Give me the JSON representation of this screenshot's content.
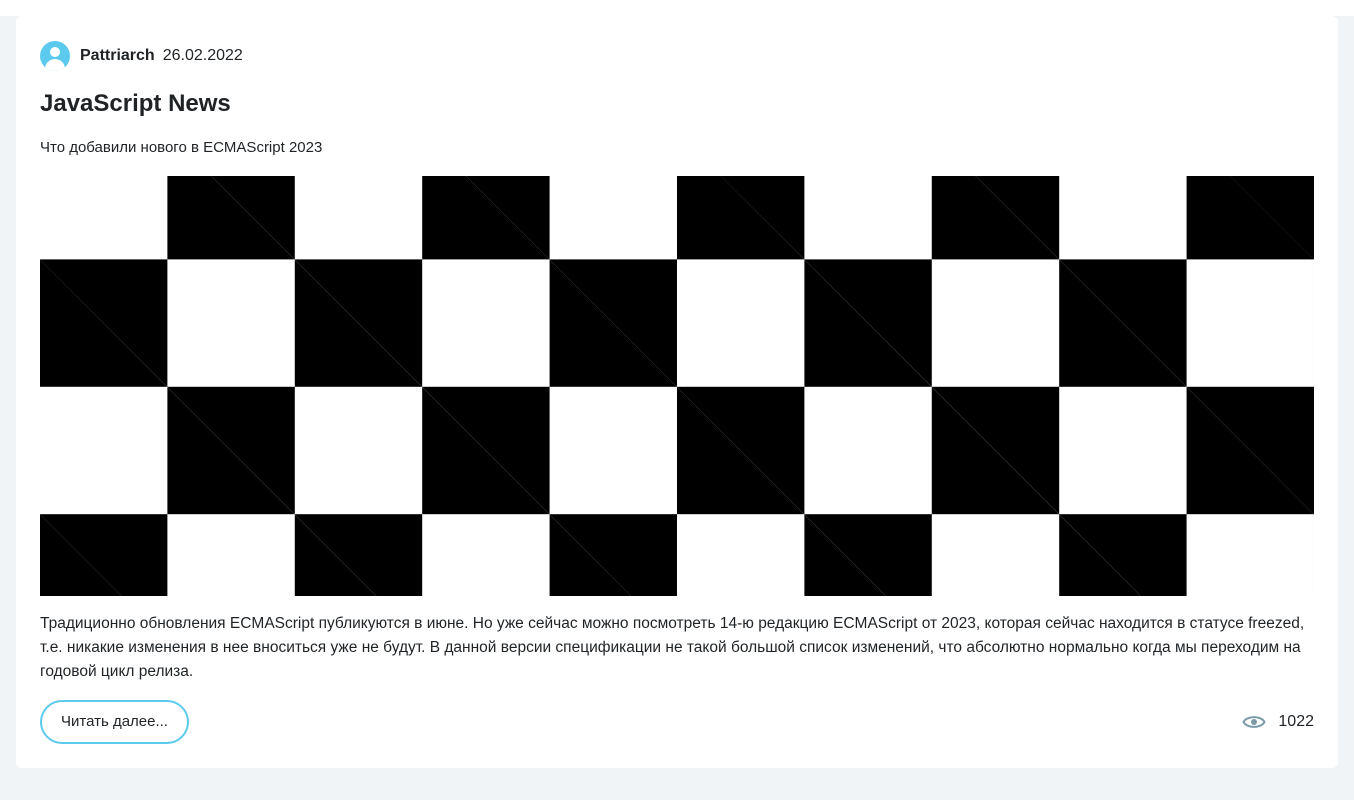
{
  "post": {
    "author": "Pattriarch",
    "date": "26.02.2022",
    "title": "JavaScript News",
    "subtitle": "Что добавили нового в ECMAScript 2023",
    "body": "Традиционно обновления ECMAScript публикуются в июне. Но уже сейчас можно посмотреть 14-ю редакцию ECMAScript от 2023, которая сейчас находится в статусе freezed, т.е. никакие изменения в нее вноситься уже не будут. В данной версии спецификации не такой большой список изменений, что абсолютно нормально когда мы переходим на годовой цикл релиза.",
    "read_more_label": "Читать далее...",
    "views": "1022"
  },
  "icons": {
    "avatar": "user-avatar-icon",
    "views": "eye-icon"
  },
  "colors": {
    "accent": "#5ccaec",
    "eye": "#7a9aa8",
    "page_bg": "#f0f4f6"
  }
}
